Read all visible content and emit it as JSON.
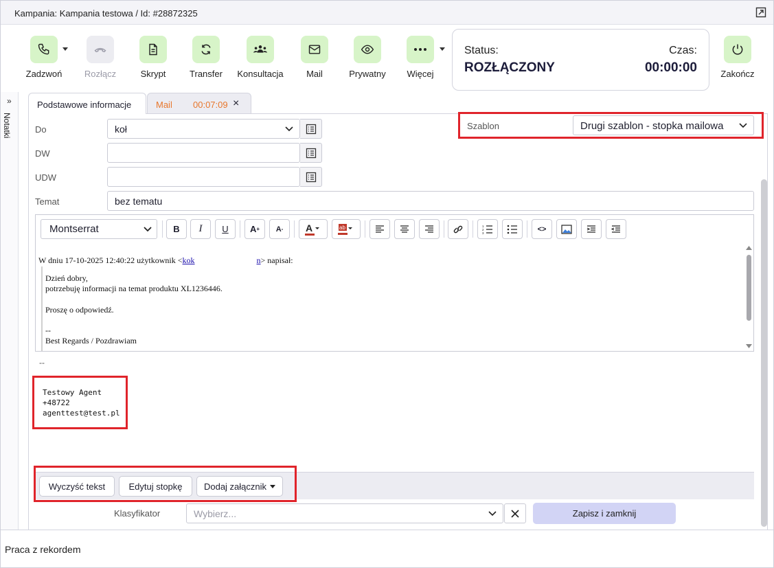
{
  "window": {
    "title": "Kampania: Kampania testowa / Id: #28872325"
  },
  "toolbar": {
    "call": "Zadzwoń",
    "hangup": "Rozłącz",
    "script": "Skrypt",
    "transfer": "Transfer",
    "consult": "Konsultacja",
    "mail": "Mail",
    "private": "Prywatny",
    "more": "Więcej",
    "finish": "Zakończ"
  },
  "status": {
    "label": "Status:",
    "value": "ROZŁĄCZONY",
    "time_label": "Czas:",
    "time_value": "00:00:00"
  },
  "notes": {
    "label": "Notatki"
  },
  "tabs": {
    "basic": "Podstawowe informacje",
    "mail": "Mail",
    "mail_timer": "00:07:09"
  },
  "form": {
    "to_label": "Do",
    "to_value": "koł",
    "cc_label": "DW",
    "bcc_label": "UDW",
    "subject_label": "Temat",
    "subject_value": "bez tematu",
    "template_label": "Szablon",
    "template_value": "Drugi szablon - stopka mailowa"
  },
  "editor": {
    "font": "Montserrat",
    "header_prefix": "W dniu 17-10-2025 12:40:22 użytkownik <",
    "header_link1": "kok",
    "header_link2": "n",
    "header_suffix": "> napisał:",
    "body_lines": [
      "Dzień dobry,",
      "potrzebuję informacji na temat produktu XL1236446.",
      "",
      "Proszę o odpowiedź.",
      "",
      "--",
      "Best Regards / Pozdrawiam"
    ]
  },
  "signature": {
    "dashes": "--",
    "lines": [
      "Testowy Agent",
      "+48722",
      "agenttest@test.pl"
    ]
  },
  "actions": {
    "clear": "Wyczyść tekst",
    "edit_footer": "Edytuj stopkę",
    "add_attachment": "Dodaj załącznik"
  },
  "classifier": {
    "label": "Klasyfikator",
    "placeholder": "Wybierz...",
    "save": "Zapisz i zamknij"
  },
  "footer": {
    "text": "Praca z rekordem"
  },
  "colors": {
    "accent_green": "#d7f4c8",
    "highlight_red": "#e0242b",
    "save_button": "#d2d4f5",
    "mail_tab_text": "#e8762b"
  }
}
